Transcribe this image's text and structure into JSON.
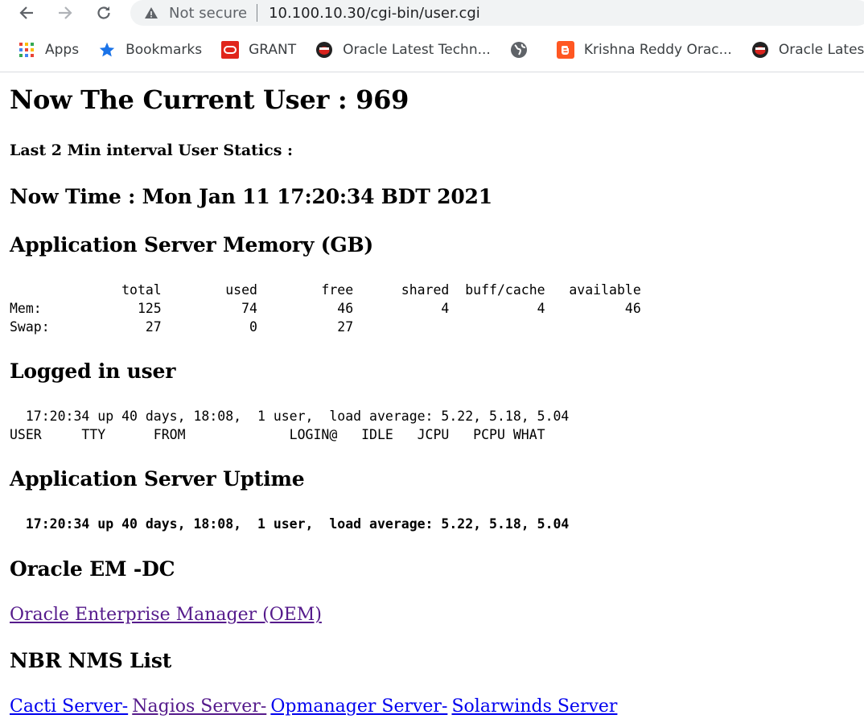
{
  "browser": {
    "back_icon": "back-arrow-icon",
    "forward_icon": "forward-arrow-icon",
    "reload_icon": "reload-icon",
    "security_label": "Not secure",
    "url": "10.100.10.30/cgi-bin/user.cgi"
  },
  "bookmarks": [
    {
      "label": "Apps",
      "icon": "apps-grid-icon"
    },
    {
      "label": "Bookmarks",
      "icon": "star-icon"
    },
    {
      "label": "GRANT",
      "icon": "oracle-logo-icon"
    },
    {
      "label": "Oracle Latest Techn...",
      "icon": "bookmark-favicon-icon"
    },
    {
      "label": "",
      "icon": "globe-icon"
    },
    {
      "label": "Krishna Reddy Orac...",
      "icon": "blogger-icon"
    },
    {
      "label": "Oracle Latest Tech",
      "icon": "bookmark-favicon-icon"
    }
  ],
  "page": {
    "current_user": "Now The Current User : 969",
    "interval_stats": "Last 2 Min interval User Statics :",
    "now_time": "Now Time : Mon Jan 11 17:20:34 BDT 2021",
    "memory_heading": "Application Server Memory (GB)",
    "memory_table": "              total        used        free      shared  buff/cache   available\nMem:            125          74          46           4           4          46\nSwap:            27           0          27",
    "logged_heading": "Logged in user",
    "logged_output": "  17:20:34 up 40 days, 18:08,  1 user,  load average: 5.22, 5.18, 5.04\nUSER     TTY      FROM             LOGIN@   IDLE   JCPU   PCPU WHAT",
    "uptime_heading": "Application Server Uptime",
    "uptime_output": "  17:20:34 up 40 days, 18:08,  1 user,  load average: 5.22, 5.18, 5.04",
    "oem_heading": "Oracle EM -DC",
    "oem_link": "Oracle Enterprise Manager (OEM)",
    "nms_heading": "NBR NMS List",
    "nms_links": [
      "Cacti Server-",
      "Nagios Server-",
      "Opmanager Server-",
      "Solarwinds Server"
    ]
  },
  "colors": {
    "link": "#0000ee",
    "link_visited": "#551a8b"
  }
}
